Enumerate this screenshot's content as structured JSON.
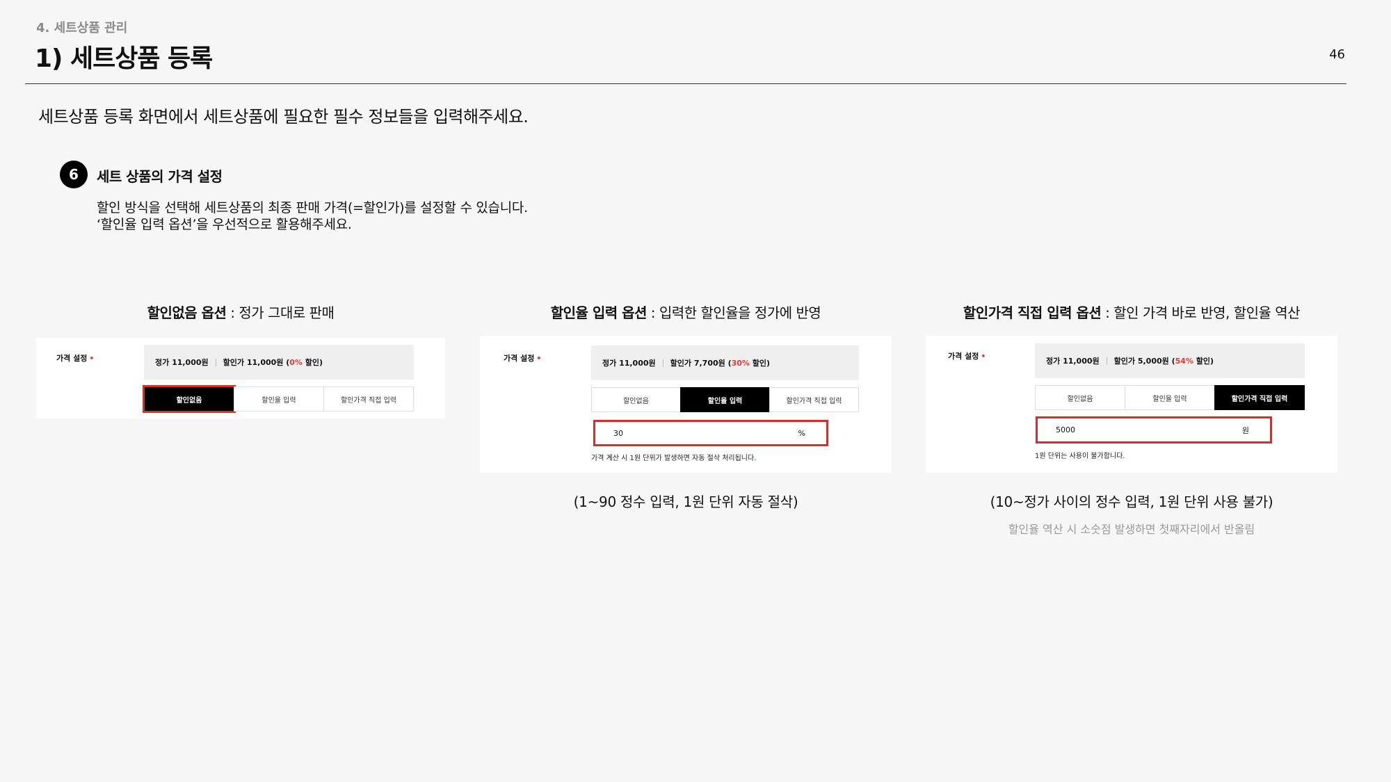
{
  "header": {
    "section": "4. 세트상품 관리",
    "title": "1) 세트상품 등록",
    "page_number": "46"
  },
  "intro": "세트상품 등록 화면에서 세트상품에 필요한 필수 정보들을 입력해주세요.",
  "step": {
    "number": "6",
    "title": "세트 상품의 가격 설정",
    "desc_line1": "할인 방식을 선택해 세트상품의 최종 판매 가격(=할인가)를 설정할 수 있습니다.",
    "desc_line2": "‘할인율 입력 옵션’을 우선적으로 활용해주세요."
  },
  "columns": [
    {
      "heading_bold": "할인없음 옵션",
      "heading_rest": " : 정가 그대로 판매",
      "field_label": "가격 설정",
      "required_mark": "•",
      "list_price": "정가 11,000원",
      "sale_prefix": "할인가 11,000원 (",
      "sale_pct": "0%",
      "sale_suffix": " 할인)",
      "tabs": [
        "할인없음",
        "할인율 입력",
        "할인가격 직접 입력"
      ],
      "active_tab": 0
    },
    {
      "heading_bold": "할인율 입력 옵션",
      "heading_rest": " : 입력한 할인율을 정가에 반영",
      "field_label": "가격 설정",
      "required_mark": "•",
      "list_price": "정가 11,000원",
      "sale_prefix": "할인가 7,700원 (",
      "sale_pct": "30%",
      "sale_suffix": " 할인)",
      "tabs": [
        "할인없음",
        "할인율 입력",
        "할인가격 직접 입력"
      ],
      "active_tab": 1,
      "input_value": "30",
      "input_unit": "%",
      "hint": "가격 계산 시 1원 단위가 발생하면 자동 절삭 처리됩니다.",
      "caption": "(1~90 정수 입력, 1원 단위 자동 절삭)"
    },
    {
      "heading_bold": "할인가격 직접 입력 옵션",
      "heading_rest": " : 할인 가격 바로 반영, 할인율 역산",
      "field_label": "가격 설정",
      "required_mark": "•",
      "list_price": "정가 11,000원",
      "sale_prefix": "할인가 5,000원 (",
      "sale_pct": "54%",
      "sale_suffix": " 할인)",
      "tabs": [
        "할인없음",
        "할인율 입력",
        "할인가격 직접 입력"
      ],
      "active_tab": 2,
      "input_value": "5000",
      "input_unit": "원",
      "hint": "1원 단위는 사용이 불가합니다.",
      "caption": "(10~정가 사이의 정수 입력, 1원 단위 사용 불가)",
      "note": "할인율 역산 시 소숫점 발생하면 첫째자리에서 반올림"
    }
  ],
  "colors": {
    "accent_red": "#e53935",
    "highlight_border": "#d32f2f",
    "active_tab": "#000000"
  }
}
